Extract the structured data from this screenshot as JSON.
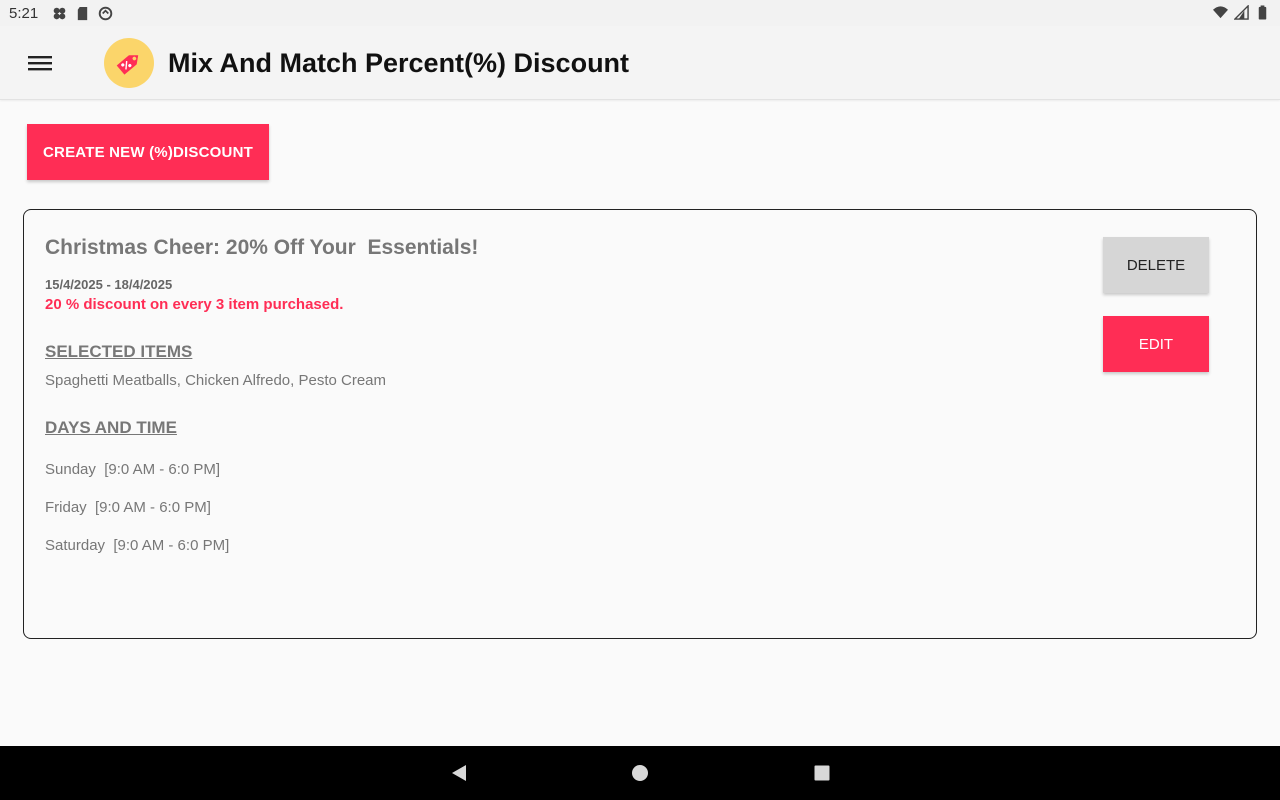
{
  "status_bar": {
    "time": "5:21",
    "icons_left": [
      "pinwheel-icon",
      "sd-card-icon",
      "sync-icon"
    ],
    "icons_right": [
      "wifi-icon",
      "signal-icon",
      "battery-icon"
    ]
  },
  "app_bar": {
    "menu_icon": "hamburger-menu-icon",
    "logo_icon": "discount-tag-icon",
    "title": "Mix And Match Percent(%) Discount"
  },
  "actions": {
    "create_label": "CREATE NEW (%)DISCOUNT"
  },
  "discount": {
    "title": "Christmas Cheer: 20% Off Your  Essentials!",
    "dates": "15/4/2025 - 18/4/2025",
    "rule": "20 % discount on every 3 item purchased.",
    "selected_items_heading": "SELECTED ITEMS",
    "selected_items": "Spaghetti Meatballs, Chicken Alfredo, Pesto Cream",
    "days_heading": "DAYS AND TIME",
    "days": [
      "Sunday  [9:0 AM - 6:0 PM]",
      "Friday  [9:0 AM - 6:0 PM]",
      "Saturday  [9:0 AM - 6:0 PM]"
    ],
    "delete_label": "DELETE",
    "edit_label": "EDIT"
  },
  "nav_bar": {
    "back_icon": "back-triangle-icon",
    "home_icon": "home-circle-icon",
    "recents_icon": "recents-square-icon"
  },
  "colors": {
    "accent": "#ff2d55",
    "logo_bg": "#fbd56a",
    "delete_bg": "#d6d6d6",
    "text_muted": "#777777"
  }
}
